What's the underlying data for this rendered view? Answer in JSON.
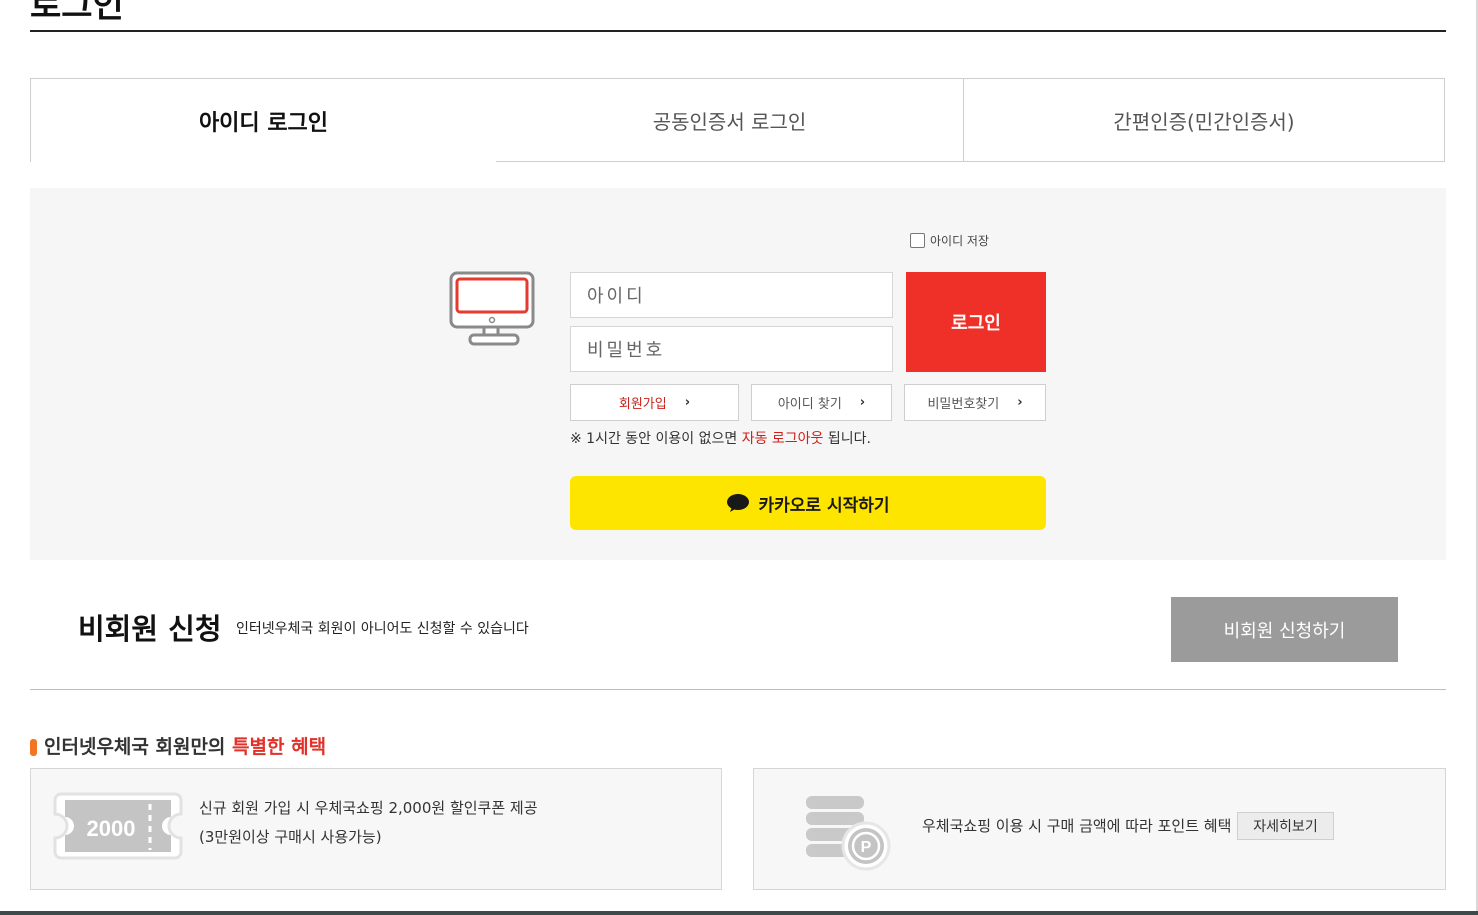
{
  "page": {
    "title": "로그인"
  },
  "tabs": [
    {
      "label": "아이디 로그인",
      "active": true
    },
    {
      "label": "공동인증서 로그인",
      "active": false
    },
    {
      "label": "간편인증(민간인증서)",
      "active": false
    }
  ],
  "login": {
    "save_id_label": "아이디 저장",
    "id_placeholder": "아이디",
    "pw_placeholder": "비밀번호",
    "login_button": "로그인",
    "signup": "회원가입",
    "find_id": "아이디 찾기",
    "find_pw": "비밀번호찾기",
    "notice_pre": "※ 1시간 동안 이용이 없으면 ",
    "notice_red": "자동 로그아웃",
    "notice_post": " 됩니다.",
    "kakao_button": "카카오로 시작하기",
    "accent_color": "#ee3029",
    "kakao_color": "#fee500"
  },
  "guest": {
    "title": "비회원 신청",
    "description": "인터넷우체국 회원이 아니어도 신청할 수 있습니다",
    "button": "비회원 신청하기"
  },
  "benefits": {
    "title_pre": "인터넷우체국 회원만의 ",
    "title_red": "특별한 혜택",
    "coupon_amount": "2000",
    "coupon_line1": "신규 회원 가입 시 우체국쇼핑 2,000원 할인쿠폰 제공",
    "coupon_line2": "(3만원이상 구매시 사용가능)",
    "point_badge": "P",
    "point_text": "우체국쇼핑 이용 시 구매 금액에 따라 포인트 혜택",
    "detail_button": "자세히보기"
  }
}
